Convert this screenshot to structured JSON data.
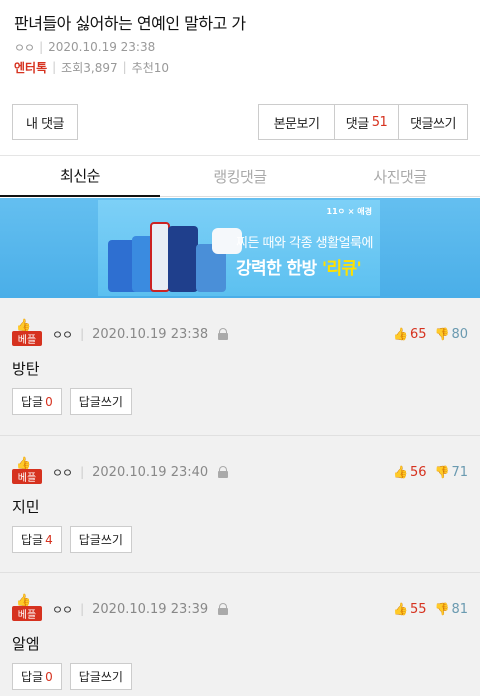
{
  "post": {
    "title": "판녀들아 싫어하는 연예인 말하고 가",
    "author": "ㅇㅇ",
    "date": "2020.10.19 23:38",
    "category": "엔터톡",
    "views_label": "조회3,897",
    "recommend_label": "추천10"
  },
  "actions": {
    "my_comments": "내 댓글",
    "view_body": "본문보기",
    "comments_label": "댓글",
    "comments_count": "51",
    "write_comment": "댓글쓰기"
  },
  "tabs": [
    {
      "label": "최신순",
      "active": true
    },
    {
      "label": "랭킹댓글",
      "active": false
    },
    {
      "label": "사진댓글",
      "active": false
    }
  ],
  "ad": {
    "brand": "11ㅇ × 애경",
    "line1": "찌든 때와 각종 생활얼룩에",
    "line2_prefix": "강력한 한방 ",
    "line2_highlight": "'리큐'"
  },
  "best_label": "베플",
  "reply_label": "답글",
  "reply_write_label": "답글쓰기",
  "comments": [
    {
      "author": "ㅇㅇ",
      "date": "2020.10.19 23:38",
      "likes": "65",
      "dislikes": "80",
      "body": "방탄",
      "replies": "0"
    },
    {
      "author": "ㅇㅇ",
      "date": "2020.10.19 23:40",
      "likes": "56",
      "dislikes": "71",
      "body": "지민",
      "replies": "4"
    },
    {
      "author": "ㅇㅇ",
      "date": "2020.10.19 23:39",
      "likes": "55",
      "dislikes": "81",
      "body": "알엠",
      "replies": "0"
    }
  ],
  "colors": {
    "accent": "#d6321f",
    "dislike": "#6a9ab0",
    "ad_bg": "#4aaee8"
  }
}
